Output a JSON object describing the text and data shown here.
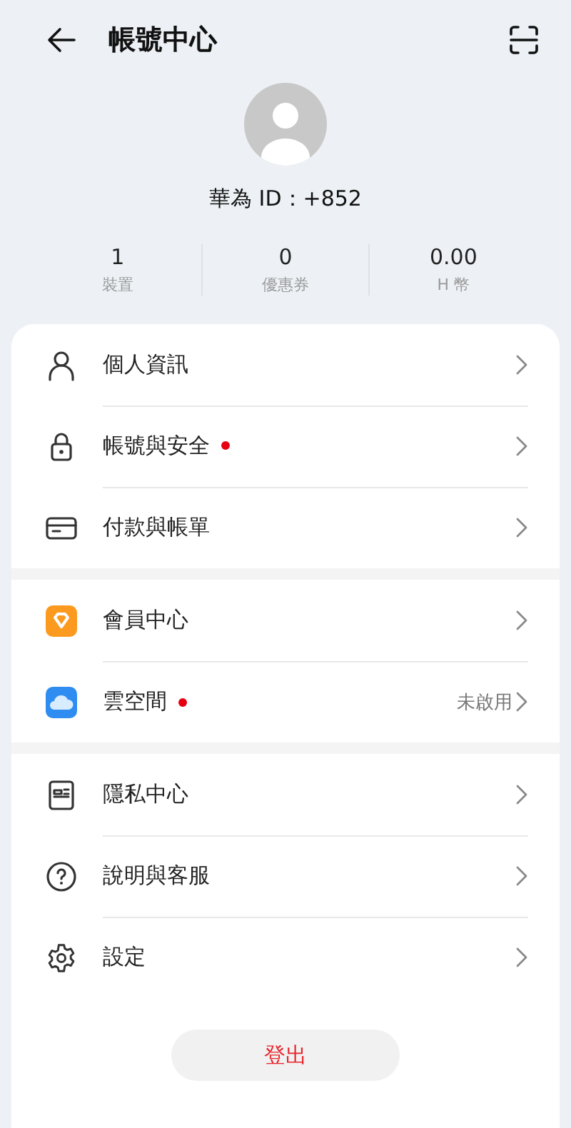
{
  "header": {
    "title": "帳號中心"
  },
  "profile": {
    "id_label": "華為 ID：+852"
  },
  "stats": [
    {
      "value": "1",
      "label": "裝置"
    },
    {
      "value": "0",
      "label": "優惠券"
    },
    {
      "value": "0.00",
      "label": "H 幣"
    }
  ],
  "groups": [
    {
      "items": [
        {
          "kind": "person",
          "label": "個人資訊",
          "dot": false
        },
        {
          "kind": "lock",
          "label": "帳號與安全",
          "dot": true
        },
        {
          "kind": "card",
          "label": "付款與帳單",
          "dot": false
        }
      ]
    },
    {
      "items": [
        {
          "kind": "vip",
          "label": "會員中心",
          "dot": false
        },
        {
          "kind": "cloud",
          "label": "雲空間",
          "dot": true,
          "value": "未啟用"
        }
      ]
    },
    {
      "items": [
        {
          "kind": "privacy",
          "label": "隱私中心",
          "dot": false
        },
        {
          "kind": "help",
          "label": "說明與客服",
          "dot": false
        },
        {
          "kind": "settings",
          "label": "設定",
          "dot": false
        }
      ]
    }
  ],
  "logout": {
    "label": "登出"
  }
}
